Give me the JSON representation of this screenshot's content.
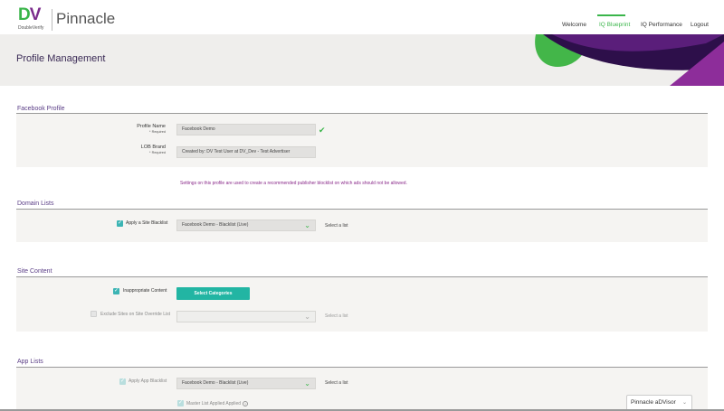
{
  "brand": {
    "logo_letters_d": "D",
    "logo_letters_v": "V",
    "logo_sub": "DoubleVerify",
    "product": "Pinnacle"
  },
  "nav": {
    "items": [
      "Welcome",
      "IQ Blueprint",
      "IQ Performance",
      "Logout"
    ],
    "active": "IQ Blueprint",
    "active_color": "#3ab54a"
  },
  "page": {
    "title": "Profile Management"
  },
  "facebook_profile": {
    "section_title": "Facebook Profile",
    "profile_name_label": "Profile Name",
    "profile_name_required": "* Required",
    "profile_name_value": "Facebook Demo",
    "lob_brand_label": "LOB Brand",
    "lob_brand_required": "* Required",
    "lob_brand_value": "Created by: DV Test User at DV_Dev - Test Advertiser"
  },
  "info_text": "Settings on this profile are used to create a recommended publisher blocklist on which ads should not be allowed.",
  "domain_lists": {
    "section_title": "Domain Lists",
    "apply_site_blacklist_label": "Apply a Site Blacklist",
    "apply_site_blacklist_checked": true,
    "blacklist_select_value": "Facebook Demo - Blacklist (Live)",
    "select_hint": "Select a list"
  },
  "site_content": {
    "section_title": "Site Content",
    "inappropriate_label": "Inappropriate Content",
    "inappropriate_checked": true,
    "select_categories_button": "Select Categories",
    "exclude_override_label": "Exclude Sites on Site Override List",
    "exclude_override_checked": false,
    "override_select_value": "",
    "select_hint": "Select a list"
  },
  "app_lists": {
    "section_title": "App Lists",
    "apply_app_blacklist_label": "Apply App Blacklist",
    "apply_app_blacklist_checked": true,
    "app_select_value": "Facebook Demo - Blacklist (Live)",
    "select_hint": "Select a list",
    "master_list_label": "Master List Applied Applied",
    "master_list_checked": true
  },
  "advisor": {
    "label": "Pinnacle aDVisor"
  },
  "colors": {
    "brand_green": "#3ab54a",
    "brand_purple": "#7b2b8c",
    "section_title": "#5a3d86",
    "checkbox_teal": "#3cb4b4",
    "button_teal": "#22b5a3",
    "info_text": "#8a2a8a"
  },
  "icons": {
    "valid": "check-icon",
    "dropdown": "chevron-down-icon",
    "help": "help-circle-icon"
  }
}
